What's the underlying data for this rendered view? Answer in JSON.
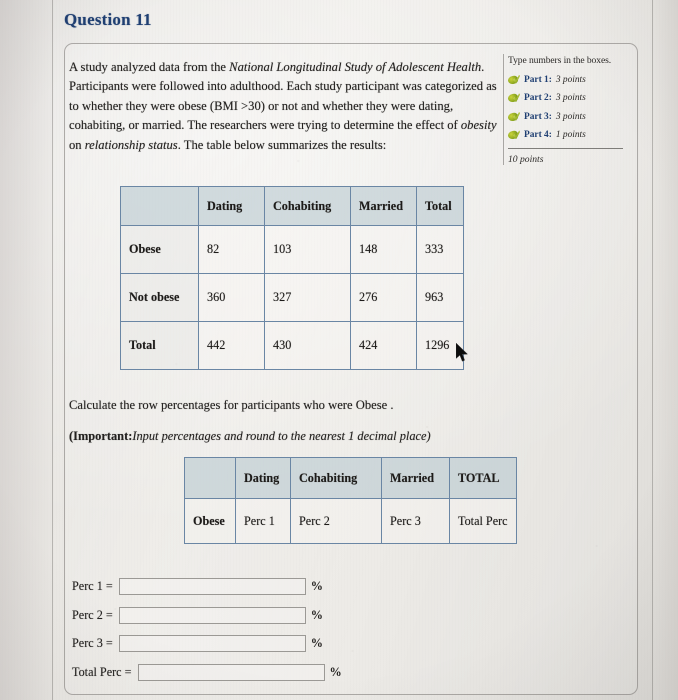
{
  "question": {
    "title": "Question 11",
    "prompt_parts": [
      {
        "text": "A study analyzed data from the ",
        "italic": false
      },
      {
        "text": "National Longitudinal Study of Adolescent Health",
        "italic": true
      },
      {
        "text": ". Participants were followed into adulthood. Each study participant was categorized as to whether they were obese (BMI >30) or not and whether they were dating, cohabiting, or married. The researchers were trying to determine the effect of ",
        "italic": false
      },
      {
        "text": "obesity",
        "italic": true
      },
      {
        "text": " on ",
        "italic": false
      },
      {
        "text": "relationship status",
        "italic": true
      },
      {
        "text": ". The table below summarizes the results:",
        "italic": false
      }
    ],
    "calculate_line": "Calculate the row percentages for participants who were Obese .",
    "important_bold": "(Important:",
    "important_italic": "Input percentages and round to the nearest 1 decimal place)"
  },
  "rail": {
    "heading": "Type numbers in the boxes.",
    "parts": [
      {
        "label": "Part 1:",
        "points": "3 points",
        "icon": "green-check-icon"
      },
      {
        "label": "Part 2:",
        "points": "3 points",
        "icon": "green-check-icon"
      },
      {
        "label": "Part 3:",
        "points": "3 points",
        "icon": "green-check-icon"
      },
      {
        "label": "Part 4:",
        "points": "1 points",
        "icon": "green-check-icon"
      }
    ],
    "total": "10 points"
  },
  "table1": {
    "headers": [
      "",
      "Dating",
      "Cohabiting",
      "Married",
      "Total"
    ],
    "rows": [
      {
        "label": "Obese",
        "cells": [
          "82",
          "103",
          "148",
          "333"
        ]
      },
      {
        "label": "Not obese",
        "cells": [
          "360",
          "327",
          "276",
          "963"
        ]
      },
      {
        "label": "Total",
        "cells": [
          "442",
          "430",
          "424",
          "1296"
        ]
      }
    ]
  },
  "table2": {
    "headers": [
      "",
      "Dating",
      "Cohabiting",
      "Married",
      "TOTAL"
    ],
    "rows": [
      {
        "label": "Obese",
        "cells": [
          "Perc 1",
          "Perc 2",
          "Perc 3",
          "Total Perc"
        ]
      }
    ]
  },
  "answers": [
    {
      "label": "Perc 1 =",
      "value": "",
      "unit": "%"
    },
    {
      "label": "Perc 2 =",
      "value": "",
      "unit": "%"
    },
    {
      "label": "Perc 3 =",
      "value": "",
      "unit": "%"
    },
    {
      "label": "Total Perc =",
      "value": "",
      "unit": "%"
    }
  ],
  "colors": {
    "title": "#1f3f72",
    "table_border": "#6a86a4",
    "table_header_fill": "#bac9d0",
    "page_bg": "#eceae6"
  }
}
